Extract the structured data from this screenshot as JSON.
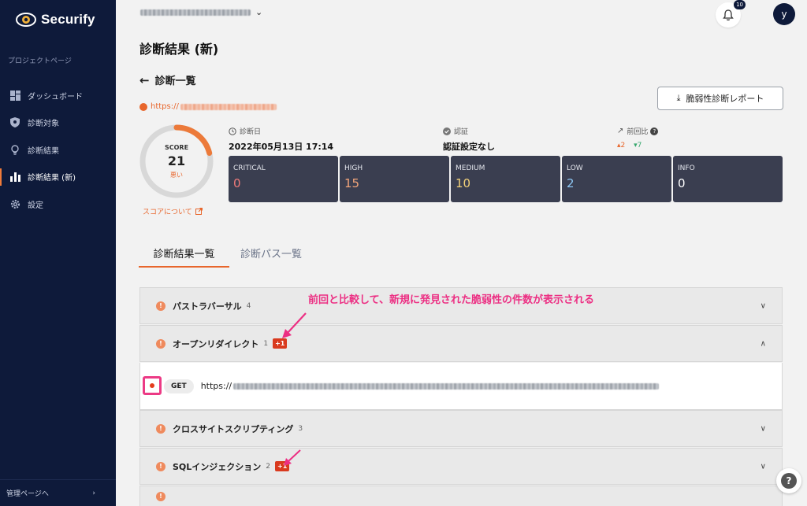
{
  "app": {
    "name": "Securify"
  },
  "sidebar": {
    "section_label": "プロジェクトページ",
    "items": [
      {
        "label": "ダッシュボード",
        "icon": "dashboard-icon"
      },
      {
        "label": "診断対象",
        "icon": "shield-icon"
      },
      {
        "label": "診断結果",
        "icon": "lightbulb-icon"
      },
      {
        "label": "診断結果 (新)",
        "icon": "bar-chart-icon",
        "active": true
      },
      {
        "label": "設定",
        "icon": "gear-icon"
      }
    ],
    "admin_label": "管理ページへ",
    "admin_arrow": "›"
  },
  "header": {
    "notification_count": "10",
    "avatar_initial": "y"
  },
  "page": {
    "title": "診断結果 (新)",
    "back_label": "診断一覧",
    "target_prefix": "https://",
    "report_button": "脆弱性診断レポート"
  },
  "score": {
    "label": "SCORE",
    "value": "21",
    "value_percent": 21,
    "grade": "悪い",
    "about": "スコアについて"
  },
  "meta": {
    "date_label": "診断日",
    "date_value": "2022年05月13日 17:14",
    "auth_label": "認証",
    "auth_value": "認証設定なし",
    "diff_label": "前回比",
    "diff_help": "?",
    "diff_up": "2",
    "diff_down": "7"
  },
  "severity": [
    {
      "name": "CRITICAL",
      "count": "0",
      "color": "#f07a7a"
    },
    {
      "name": "HIGH",
      "count": "15",
      "color": "#f2a57a"
    },
    {
      "name": "MEDIUM",
      "count": "10",
      "color": "#f3d27a"
    },
    {
      "name": "LOW",
      "count": "2",
      "color": "#8ec8f5"
    },
    {
      "name": "INFO",
      "count": "0",
      "color": "#ffffff"
    }
  ],
  "tabs": [
    {
      "label": "診断結果一覧",
      "active": true
    },
    {
      "label": "診断パス一覧",
      "active": false
    }
  ],
  "findings": [
    {
      "title": "パストラバーサル",
      "count": "4",
      "expanded": false
    },
    {
      "title": "オープンリダイレクト",
      "count": "1",
      "new_badge": "+1",
      "expanded": true
    },
    {
      "title": "クロスサイトスクリプティング",
      "count": "3",
      "expanded": false
    },
    {
      "title": "SQLインジェクション",
      "count": "2",
      "new_badge": "+1",
      "expanded": false
    }
  ],
  "finding_detail": {
    "method": "GET",
    "url_prefix": "https://"
  },
  "annotation": {
    "text": "前回と比較して、新規に発見された脆弱性の件数が表示される",
    "color": "#ec2f83"
  },
  "float_help": "?"
}
